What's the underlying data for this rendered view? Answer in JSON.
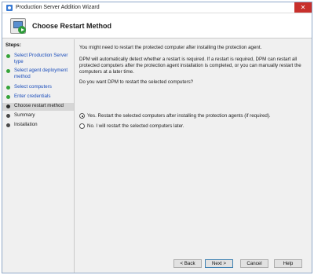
{
  "window": {
    "title": "Production Server Addition Wizard",
    "close_glyph": "✕"
  },
  "header": {
    "title": "Choose Restart Method"
  },
  "steps": {
    "label": "Steps:",
    "items": [
      {
        "label": "Select Production Server type",
        "state": "done"
      },
      {
        "label": "Select agent deployment method",
        "state": "done"
      },
      {
        "label": "Select computers",
        "state": "done"
      },
      {
        "label": "Enter credentials",
        "state": "done"
      },
      {
        "label": "Choose restart method",
        "state": "active"
      },
      {
        "label": "Summary",
        "state": "pending"
      },
      {
        "label": "Installation",
        "state": "pending"
      }
    ]
  },
  "main": {
    "intro": "You might need to restart the protected computer after installing the protection agent.",
    "detail": "DPM will automatically detect whether a restart is required. If a restart is required, DPM can restart all protected computers after the protection agent installation is completed, or you can manually restart the computers at a later time.",
    "question": "Do you want DPM to restart the selected computers?",
    "options": [
      {
        "label": "Yes. Restart the selected computers after installing the protection agents (if required).",
        "selected": true
      },
      {
        "label": "No. I will restart the selected computers later.",
        "selected": false
      }
    ]
  },
  "buttons": {
    "back": "< Back",
    "next": "Next >",
    "cancel": "Cancel",
    "help": "Help"
  }
}
